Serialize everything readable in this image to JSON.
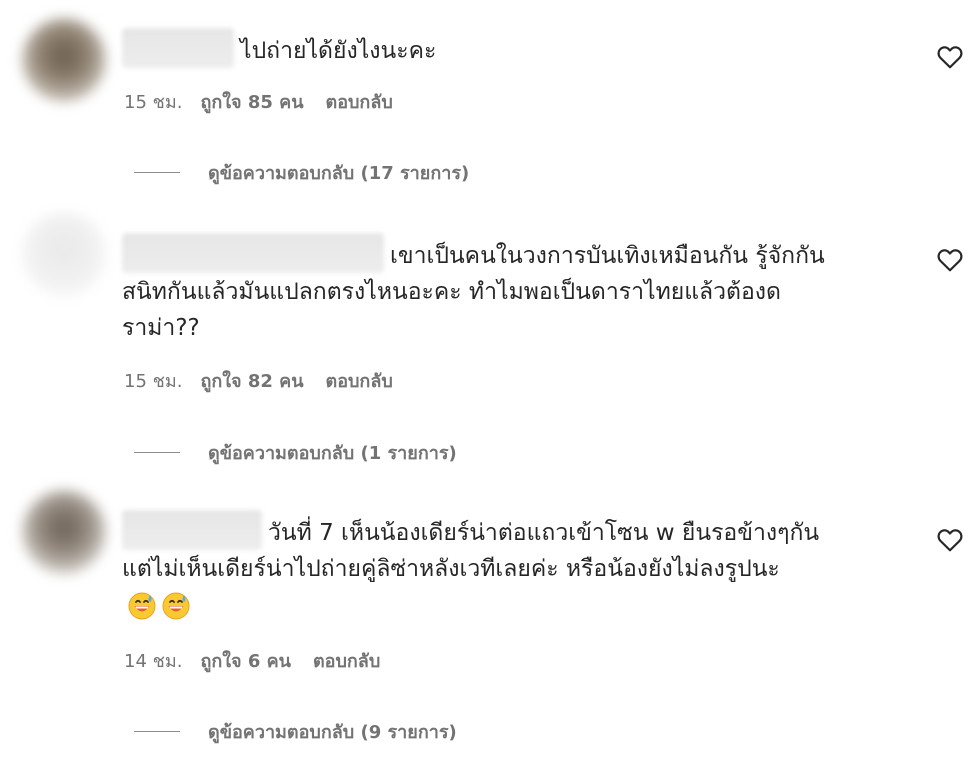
{
  "comments": [
    {
      "text": "ไปถ่ายได้ยังไงนะคะ",
      "time": "15 ชม.",
      "likes": "ถูกใจ 85 คน",
      "reply": "ตอบกลับ",
      "view_replies": "ดูข้อความตอบกลับ (17 รายการ)"
    },
    {
      "text_line1": "เขาเป็นคนในวงการบันเทิงเหมือนกัน รู้จักกัน",
      "text_line2": "สนิทกันแล้วมันแปลกตรงไหนอะคะ ทำไมพอเป็นดาราไทยแล้วต้องด",
      "text_line3": "ราม่า??",
      "time": "15 ชม.",
      "likes": "ถูกใจ 82 คน",
      "reply": "ตอบกลับ",
      "view_replies": "ดูข้อความตอบกลับ (1 รายการ)"
    },
    {
      "text_line1": "วันที่ 7 เห็นน้องเดียร์น่าต่อแถวเข้าโซน w ยืนรอข้างๆกัน",
      "text_line2": "แต่ไม่เห็นเดียร์น่าไปถ่ายคู่ลิซ่าหลังเวทีเลยค่ะ หรือน้องยังไม่ลงรูปนะ",
      "emojis": [
        "grinning-sweat-emoji",
        "grinning-sweat-emoji"
      ],
      "time": "14 ชม.",
      "likes": "ถูกใจ 6 คน",
      "reply": "ตอบกลับ",
      "view_replies": "ดูข้อความตอบกลับ (9 รายการ)"
    }
  ],
  "icons": {
    "like": "heart-outline-icon"
  },
  "colors": {
    "text": "#262626",
    "secondary": "#737373",
    "divider": "#8e8e8e"
  }
}
